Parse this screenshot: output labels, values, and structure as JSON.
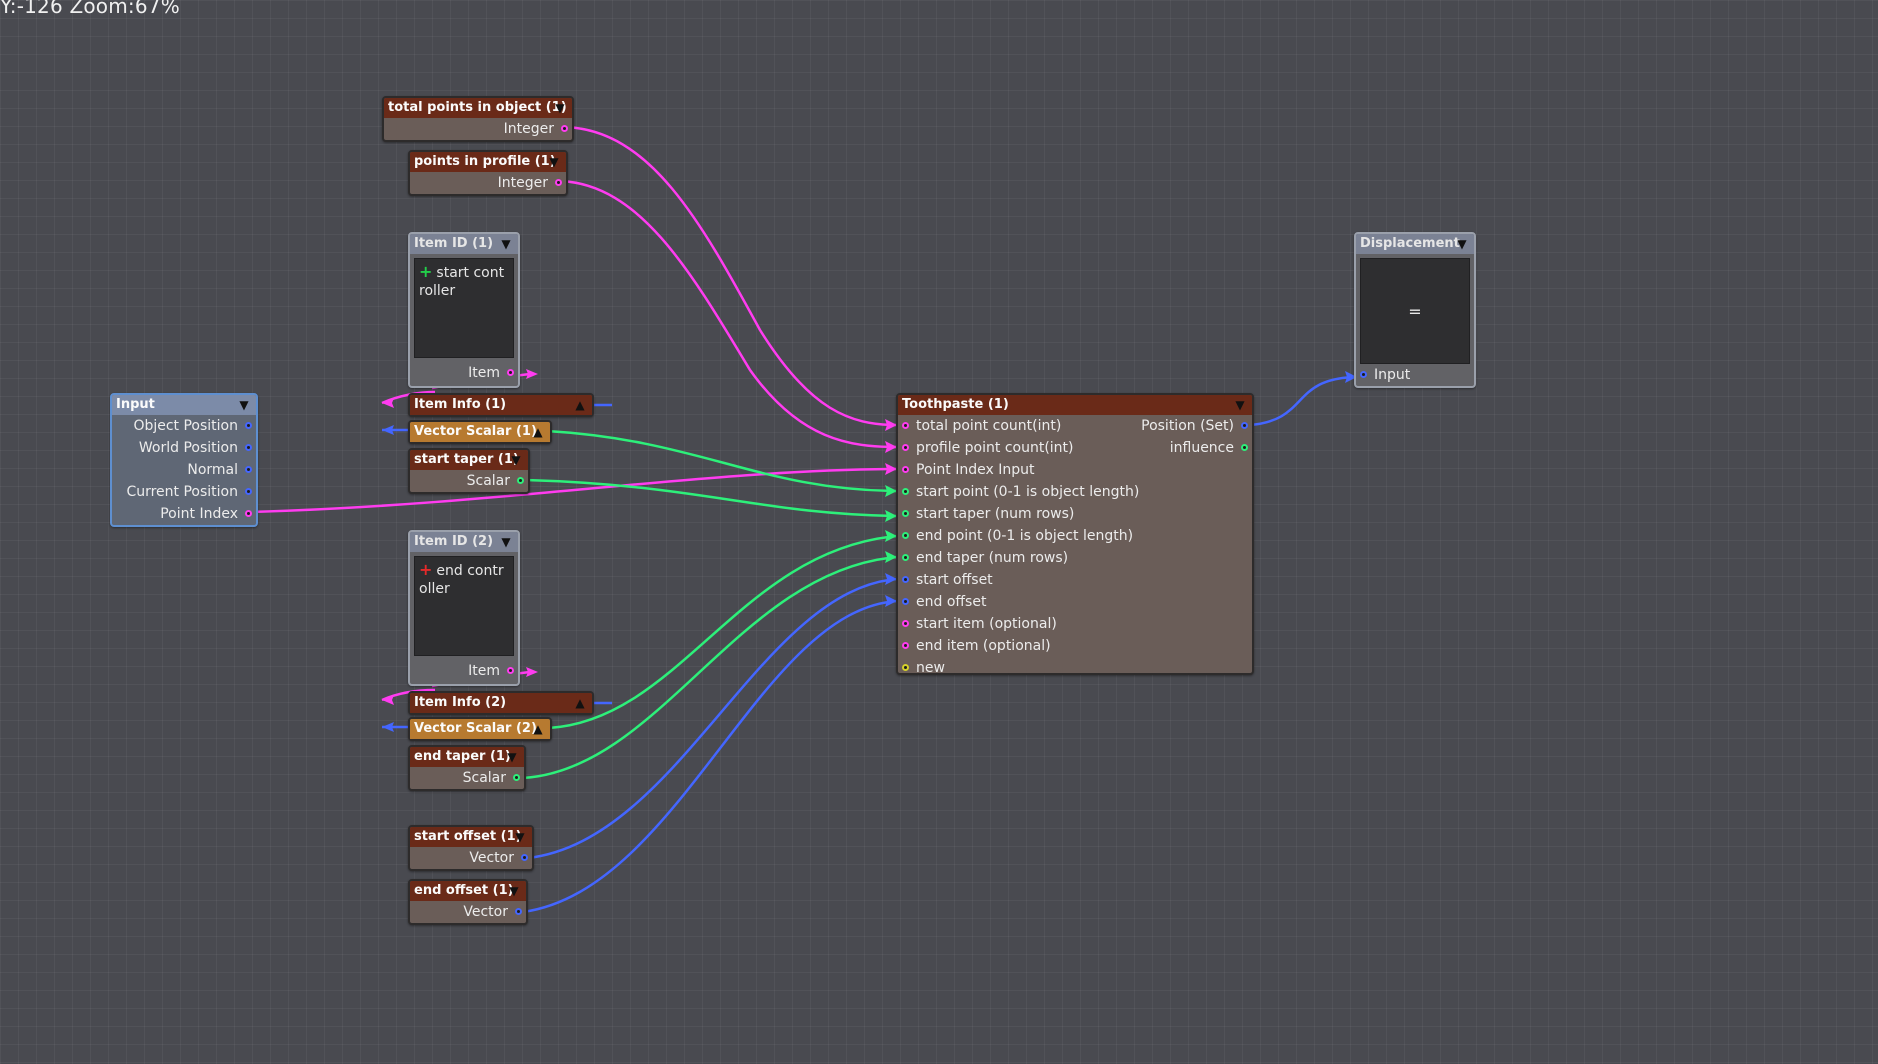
{
  "status_bar": "Y:-126 Zoom:67%",
  "colors": {
    "background": "#494a50",
    "wire_pink": "#ff3cf0",
    "wire_green": "#2df07a",
    "wire_blue": "#4466ff"
  },
  "nodes": {
    "total_points": {
      "title": "total points in object (1)",
      "outputs": [
        "Integer"
      ]
    },
    "points_profile": {
      "title": "points in profile (1)",
      "outputs": [
        "Integer"
      ]
    },
    "item_id_1": {
      "title": "Item ID (1)",
      "text": "start controller",
      "output": "Item"
    },
    "item_info_1": {
      "title": "Item Info (1)"
    },
    "vector_scalar_1": {
      "title": "Vector Scalar (1)"
    },
    "start_taper": {
      "title": "start taper (1)",
      "outputs": [
        "Scalar"
      ]
    },
    "item_id_2": {
      "title": "Item ID (2)",
      "text": "end controller",
      "output": "Item"
    },
    "item_info_2": {
      "title": "Item Info (2)"
    },
    "vector_scalar_2": {
      "title": "Vector Scalar (2)"
    },
    "end_taper": {
      "title": "end taper (1)",
      "outputs": [
        "Scalar"
      ]
    },
    "start_offset": {
      "title": "start offset (1)",
      "outputs": [
        "Vector"
      ]
    },
    "end_offset": {
      "title": "end offset (1)",
      "outputs": [
        "Vector"
      ]
    },
    "input": {
      "title": "Input",
      "outputs": [
        "Object Position",
        "World Position",
        "Normal",
        "Current Position",
        "Point Index"
      ]
    },
    "toothpaste": {
      "title": "Toothpaste (1)",
      "inputs": [
        "total point count(int)",
        "profile point count(int)",
        "Point Index Input",
        "start point (0-1 is object length)",
        "start taper (num rows)",
        "end point (0-1 is object length)",
        "end taper (num rows)",
        "start offset",
        "end offset",
        "start item (optional)",
        "end item (optional)",
        "new"
      ],
      "outputs": [
        "Position (Set)",
        "influence"
      ]
    },
    "displacement": {
      "title": "Displacement",
      "value": "=",
      "inputs": [
        "Input"
      ]
    }
  }
}
